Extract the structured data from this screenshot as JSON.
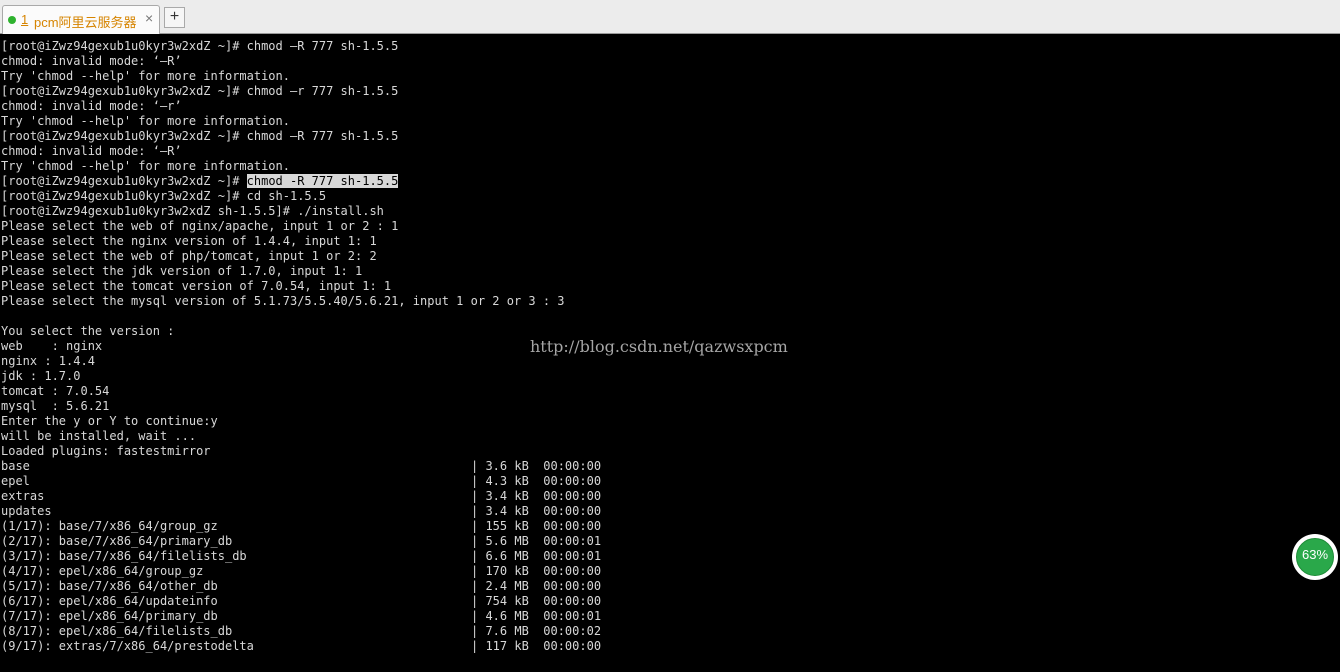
{
  "tab": {
    "number": "1",
    "title": "pcm阿里云服务器",
    "close_glyph": "×",
    "new_tab_glyph": "+",
    "status_color": "#2fb22f",
    "accent_color": "#d68400"
  },
  "terminal": {
    "lines": [
      "[root@iZwz94gexub1u0kyr3w2xdZ ~]# chmod –R 777 sh-1.5.5",
      "chmod: invalid mode: ‘–R’",
      "Try 'chmod --help' for more information.",
      "[root@iZwz94gexub1u0kyr3w2xdZ ~]# chmod –r 777 sh-1.5.5",
      "chmod: invalid mode: ‘–r’",
      "Try 'chmod --help' for more information.",
      "[root@iZwz94gexub1u0kyr3w2xdZ ~]# chmod –R 777 sh-1.5.5",
      "chmod: invalid mode: ‘–R’",
      "Try 'chmod --help' for more information.",
      "",
      "[root@iZwz94gexub1u0kyr3w2xdZ ~]# cd sh-1.5.5",
      "[root@iZwz94gexub1u0kyr3w2xdZ sh-1.5.5]# ./install.sh",
      "Please select the web of nginx/apache, input 1 or 2 : 1",
      "Please select the nginx version of 1.4.4, input 1: 1",
      "Please select the web of php/tomcat, input 1 or 2: 2",
      "Please select the jdk version of 1.7.0, input 1: 1",
      "Please select the tomcat version of 7.0.54, input 1: 1",
      "Please select the mysql version of 5.1.73/5.5.40/5.6.21, input 1 or 2 or 3 : 3",
      "",
      "You select the version :",
      "web    : nginx",
      "nginx : 1.4.4",
      "jdk : 1.7.0",
      "tomcat : 7.0.54",
      "mysql  : 5.6.21",
      "Enter the y or Y to continue:y",
      "will be installed, wait ...",
      "Loaded plugins: fastestmirror"
    ],
    "selected_prompt": "[root@iZwz94gexub1u0kyr3w2xdZ ~]# ",
    "selected_text": "chmod -R 777 sh-1.5.5",
    "downloads": [
      {
        "name": "base",
        "size": "| 3.6 kB  00:00:00"
      },
      {
        "name": "epel",
        "size": "| 4.3 kB  00:00:00"
      },
      {
        "name": "extras",
        "size": "| 3.4 kB  00:00:00"
      },
      {
        "name": "updates",
        "size": "| 3.4 kB  00:00:00"
      },
      {
        "name": "(1/17): base/7/x86_64/group_gz",
        "size": "| 155 kB  00:00:00"
      },
      {
        "name": "(2/17): base/7/x86_64/primary_db",
        "size": "| 5.6 MB  00:00:01"
      },
      {
        "name": "(3/17): base/7/x86_64/filelists_db",
        "size": "| 6.6 MB  00:00:01"
      },
      {
        "name": "(4/17): epel/x86_64/group_gz",
        "size": "| 170 kB  00:00:00"
      },
      {
        "name": "(5/17): base/7/x86_64/other_db",
        "size": "| 2.4 MB  00:00:00"
      },
      {
        "name": "(6/17): epel/x86_64/updateinfo",
        "size": "| 754 kB  00:00:00"
      },
      {
        "name": "(7/17): epel/x86_64/primary_db",
        "size": "| 4.6 MB  00:00:01"
      },
      {
        "name": "(8/17): epel/x86_64/filelists_db",
        "size": "| 7.6 MB  00:00:02"
      },
      {
        "name": "(9/17): extras/7/x86_64/prestodelta",
        "size": "| 117 kB  00:00:00"
      }
    ]
  },
  "watermark": "http://blog.csdn.net/qazwsxpcm",
  "gauge": {
    "label": "63%",
    "percent": 63,
    "color": "#2aa84a"
  }
}
